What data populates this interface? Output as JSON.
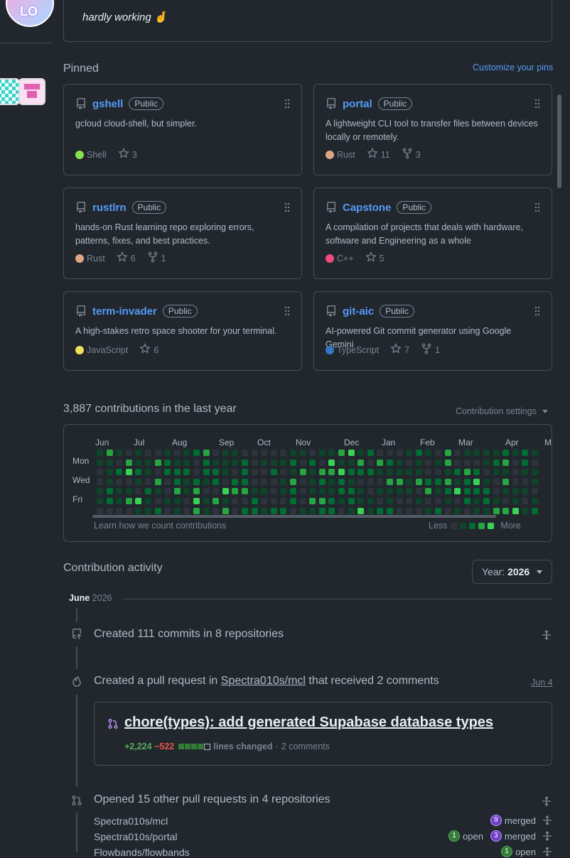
{
  "profile": {
    "status_text": "hardly working",
    "status_emoji": "🤞",
    "avatar_text": "LO"
  },
  "pinned": {
    "heading": "Pinned",
    "customize_label": "Customize your pins",
    "repos": [
      {
        "name": "gshell",
        "visibility": "Public",
        "description": "gcloud cloud-shell, but simpler.",
        "language": "Shell",
        "lang_color": "#89e051",
        "stars": "3",
        "forks": ""
      },
      {
        "name": "portal",
        "visibility": "Public",
        "description": "A lightweight CLI tool to transfer files between devices locally or remotely.",
        "language": "Rust",
        "lang_color": "#dea584",
        "stars": "11",
        "forks": "3"
      },
      {
        "name": "rustlrn",
        "visibility": "Public",
        "description": "hands-on Rust learning repo exploring errors, patterns, fixes, and best practices.",
        "language": "Rust",
        "lang_color": "#dea584",
        "stars": "6",
        "forks": "1"
      },
      {
        "name": "Capstone",
        "visibility": "Public",
        "description": "A compilation of projects that deals with hardware, software and Engineering as a whole",
        "language": "C++",
        "lang_color": "#f34b7d",
        "stars": "5",
        "forks": ""
      },
      {
        "name": "term-invader",
        "visibility": "Public",
        "description": "A high-stakes retro space shooter for your terminal.",
        "language": "JavaScript",
        "lang_color": "#f1e05a",
        "stars": "6",
        "forks": ""
      },
      {
        "name": "git-aic",
        "visibility": "Public",
        "description": "AI-powered Git commit generator using Google Gemini",
        "language": "TypeScript",
        "lang_color": "#3178c6",
        "stars": "7",
        "forks": "1"
      }
    ]
  },
  "contributions": {
    "heading": "3,887 contributions in the last year",
    "settings_label": "Contribution settings",
    "months": [
      "Jun",
      "Jul",
      "Aug",
      "Sep",
      "Oct",
      "Nov",
      "Dec",
      "Jan",
      "Feb",
      "Mar",
      "Apr",
      "M"
    ],
    "day_labels": [
      "Mon",
      "Wed",
      "Fri"
    ],
    "learn_link": "Learn how we count contributions",
    "less_label": "Less",
    "more_label": "More",
    "levels": [
      "#2d333b",
      "#0e4429",
      "#006d32",
      "#26a641",
      "#39d353"
    ]
  },
  "activity": {
    "heading": "Contribution activity",
    "year_label": "Year:",
    "year_value": "2026",
    "month_label": "June",
    "month_year": "2026",
    "commits_text": "Created 111 commits in 8 repositories",
    "pr_prefix": "Created a pull request in",
    "pr_repo": "Spectra010s/mcl",
    "pr_suffix": "that received 2 comments",
    "pr_date": "Jun 4",
    "pr_title": "chore(types): add generated Supabase database types",
    "pr_additions": "+2,224",
    "pr_deletions": "−522",
    "pr_lines_label": "lines changed",
    "pr_comments": "2 comments",
    "opened_text": "Opened 15 other pull requests in 4 repositories",
    "sub_repos": [
      {
        "name": "Spectra010s/mcl",
        "open": "",
        "merged": "9"
      },
      {
        "name": "Spectra010s/portal",
        "open": "1",
        "merged": "3"
      },
      {
        "name": "Flowbands/flowbands",
        "open": "1",
        "merged": ""
      }
    ],
    "open_word": "open",
    "merged_word": "merged"
  }
}
